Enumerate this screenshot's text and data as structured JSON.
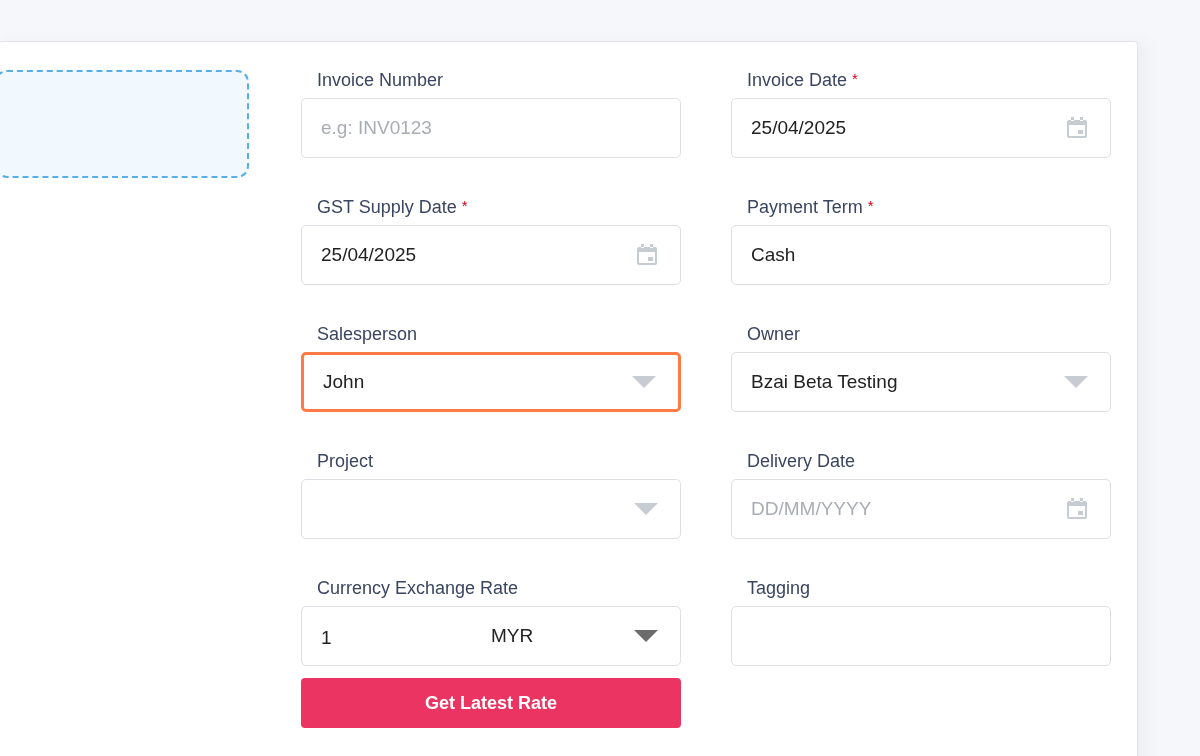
{
  "fields": [
    {
      "label": "Invoice Number",
      "kind": "text",
      "placeholder": "e.g: INV0123",
      "highlighted": false
    },
    {
      "label": "Invoice Date",
      "required_mark": "*",
      "kind": "date",
      "value": "25/04/2025",
      "highlighted": false
    },
    {
      "label": "GST Supply Date",
      "required_mark": "*",
      "kind": "date",
      "value": "25/04/2025",
      "highlighted": false
    },
    {
      "label": "Payment Term",
      "required_mark": "*",
      "kind": "text",
      "value": "Cash",
      "highlighted": false
    },
    {
      "label": "Salesperson",
      "kind": "select",
      "value": "John",
      "highlighted": true
    },
    {
      "label": "Owner",
      "kind": "select",
      "value": "Bzai Beta Testing",
      "highlighted": false
    },
    {
      "label": "Project",
      "kind": "select",
      "highlighted": false
    },
    {
      "label": "Delivery Date",
      "kind": "date",
      "placeholder": "DD/MM/YYYY",
      "highlighted": false
    },
    {
      "label": "Currency Exchange Rate",
      "kind": "currency",
      "value": "1",
      "currency": "MYR",
      "highlighted": false
    },
    {
      "label": "Tagging",
      "kind": "text",
      "highlighted": false
    }
  ],
  "rate_button": "Get Latest Rate"
}
